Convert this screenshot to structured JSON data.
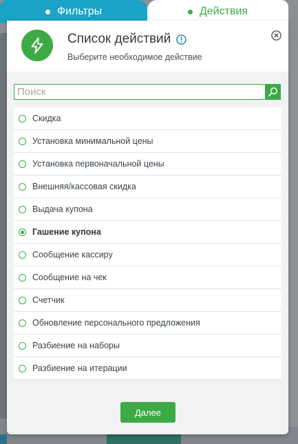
{
  "tabs": [
    {
      "label": "Фильтры",
      "active": false
    },
    {
      "label": "Действия",
      "active": true
    }
  ],
  "header": {
    "icon": "lightning-icon",
    "title": "Список действий",
    "subtitle": "Выберите необходимое действие"
  },
  "search": {
    "placeholder": "Поиск",
    "value": ""
  },
  "actions": [
    {
      "label": "Скидка",
      "selected": false
    },
    {
      "label": "Установка минимальной цены",
      "selected": false
    },
    {
      "label": "Установка первоначальной цены",
      "selected": false
    },
    {
      "label": "Внешняя/кассовая скидка",
      "selected": false
    },
    {
      "label": "Выдача купона",
      "selected": false
    },
    {
      "label": "Гашение купона",
      "selected": true
    },
    {
      "label": "Сообщение кассиру",
      "selected": false
    },
    {
      "label": "Сообщение на чек",
      "selected": false
    },
    {
      "label": "Счетчик",
      "selected": false
    },
    {
      "label": "Обновление персонального предложения",
      "selected": false
    },
    {
      "label": "Разбиение на наборы",
      "selected": false
    },
    {
      "label": "Разбиение на итерации",
      "selected": false
    }
  ],
  "footer": {
    "next_label": "Далее"
  },
  "colors": {
    "accent": "#3daa45",
    "tab_inactive": "#1aa3c7",
    "info": "#1a7fb5"
  }
}
